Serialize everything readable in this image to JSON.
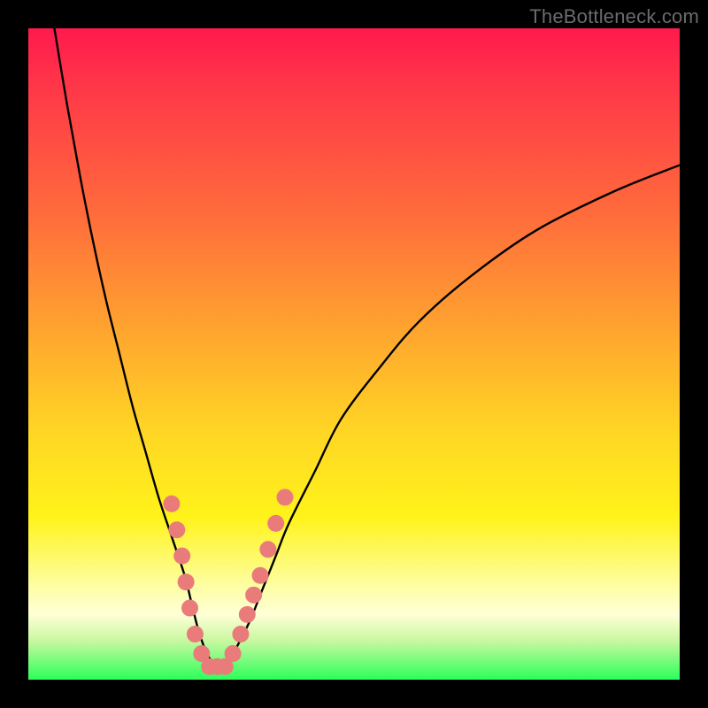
{
  "watermark": "TheBottleneck.com",
  "chart_data": {
    "type": "line",
    "title": "",
    "xlabel": "",
    "ylabel": "",
    "xlim": [
      0,
      100
    ],
    "ylim": [
      0,
      100
    ],
    "series": [
      {
        "name": "curve",
        "x": [
          4,
          6,
          8,
          10,
          12,
          14,
          16,
          18,
          20,
          22,
          24,
          25,
          26,
          27,
          28,
          29,
          30,
          31,
          32,
          34,
          36,
          38,
          40,
          44,
          48,
          54,
          60,
          68,
          78,
          90,
          100
        ],
        "y": [
          100,
          88,
          77,
          67,
          58,
          50,
          42,
          35,
          28,
          22,
          16,
          12,
          8,
          5,
          3,
          2,
          2,
          3,
          5,
          9,
          14,
          19,
          24,
          32,
          40,
          48,
          55,
          62,
          69,
          75,
          79
        ]
      }
    ],
    "markers": {
      "name": "highlight-dots",
      "color": "#e97b7b",
      "points": [
        {
          "x": 22.0,
          "y": 27
        },
        {
          "x": 22.8,
          "y": 23
        },
        {
          "x": 23.6,
          "y": 19
        },
        {
          "x": 24.2,
          "y": 15
        },
        {
          "x": 24.8,
          "y": 11
        },
        {
          "x": 25.6,
          "y": 7
        },
        {
          "x": 26.6,
          "y": 4
        },
        {
          "x": 27.8,
          "y": 2
        },
        {
          "x": 29.0,
          "y": 2
        },
        {
          "x": 30.2,
          "y": 2
        },
        {
          "x": 31.4,
          "y": 4
        },
        {
          "x": 32.6,
          "y": 7
        },
        {
          "x": 33.6,
          "y": 10
        },
        {
          "x": 34.6,
          "y": 13
        },
        {
          "x": 35.6,
          "y": 16
        },
        {
          "x": 36.8,
          "y": 20
        },
        {
          "x": 38.0,
          "y": 24
        },
        {
          "x": 39.4,
          "y": 28
        }
      ]
    }
  }
}
